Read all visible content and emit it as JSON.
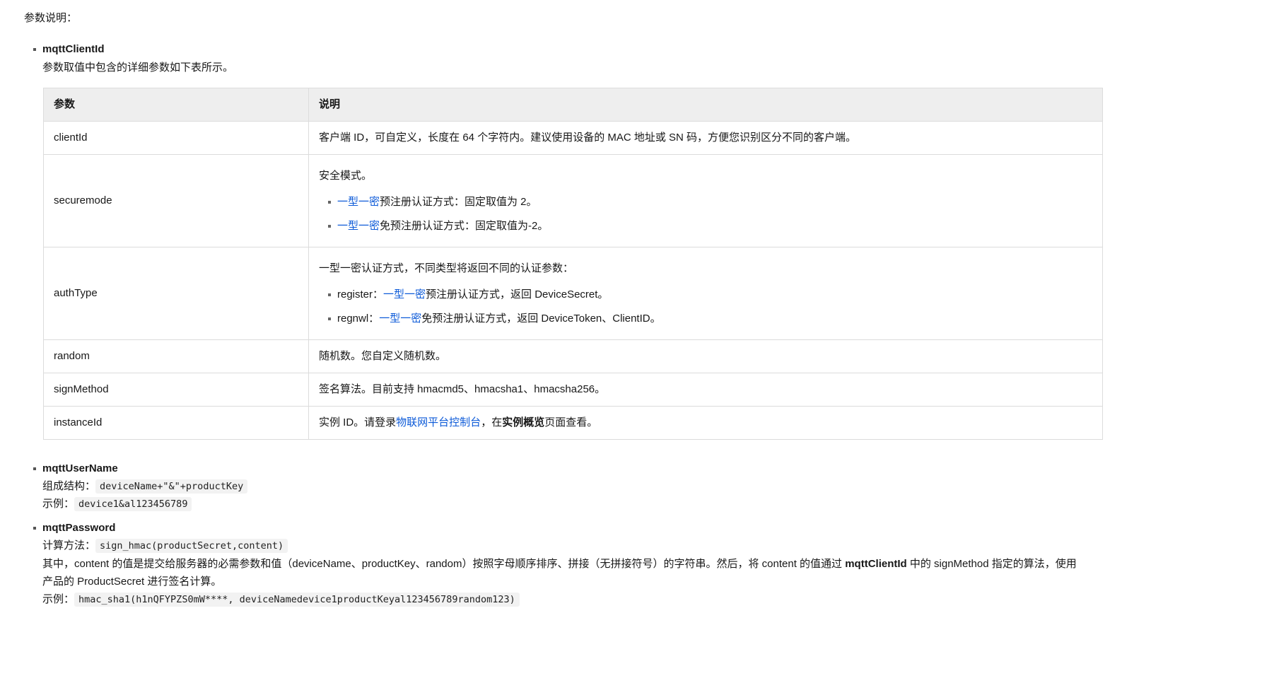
{
  "intro": "参数说明：",
  "client": {
    "term": "mqttClientId",
    "desc": "参数取值中包含的详细参数如下表所示。",
    "table": {
      "headers": [
        "参数",
        "说明"
      ],
      "rows": {
        "clientId": {
          "name": "clientId",
          "desc": "客户端 ID，可自定义，长度在 64 个字符内。建议使用设备的 MAC 地址或 SN 码，方便您识别区分不同的客户端。"
        },
        "securemode": {
          "name": "securemode",
          "lead": "安全模式。",
          "opt1_link": "一型一密",
          "opt1_text": "预注册认证方式：固定取值为 2。",
          "opt2_link": "一型一密",
          "opt2_text": "免预注册认证方式：固定取值为-2。"
        },
        "authType": {
          "name": "authType",
          "lead": "一型一密认证方式，不同类型将返回不同的认证参数：",
          "opt1_pre": "register：",
          "opt1_link": "一型一密",
          "opt1_text": "预注册认证方式，返回 DeviceSecret。",
          "opt2_pre": "regnwl：",
          "opt2_link": "一型一密",
          "opt2_text": "免预注册认证方式，返回 DeviceToken、ClientID。"
        },
        "random": {
          "name": "random",
          "desc": "随机数。您自定义随机数。"
        },
        "signMethod": {
          "name": "signMethod",
          "desc": "签名算法。目前支持 hmacmd5、hmacsha1、hmacsha256。"
        },
        "instanceId": {
          "name": "instanceId",
          "pre": "实例 ID。请登录",
          "link": "物联网平台控制台",
          "mid": "，在",
          "bold": "实例概览",
          "post": "页面查看。"
        }
      }
    }
  },
  "username": {
    "term": "mqttUserName",
    "struct_label": "组成结构：",
    "struct_code": "deviceName+\"&\"+productKey",
    "example_label": "示例：",
    "example_code": "device1&al123456789"
  },
  "password": {
    "term": "mqttPassword",
    "calc_label": "计算方法：",
    "calc_code": "sign_hmac(productSecret,content)",
    "desc_pre": "其中，content 的值是提交给服务器的必需参数和值（deviceName、productKey、random）按照字母顺序排序、拼接（无拼接符号）的字符串。然后，将 content 的值通过 ",
    "desc_bold": "mqttClientId",
    "desc_mid": " 中的 signMethod 指定的算法，使用",
    "desc_line2": "产品的 ProductSecret 进行签名计算。",
    "example_label": "示例：",
    "example_code": "hmac_sha1(h1nQFYPZS0mW****, deviceNamedevice1productKeyal123456789random123)"
  }
}
